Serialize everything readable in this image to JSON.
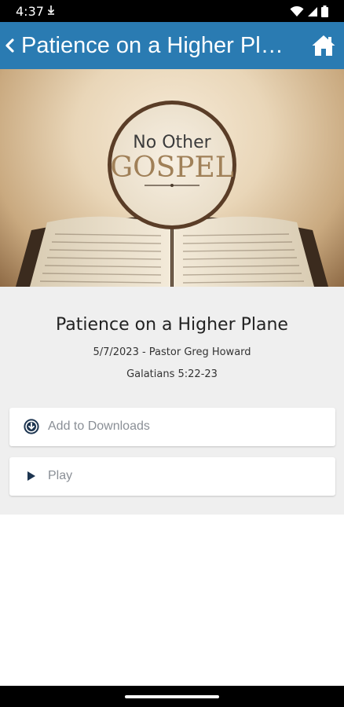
{
  "status_bar": {
    "time": "4:37"
  },
  "app_bar": {
    "title": "Patience on a Higher Plane"
  },
  "hero": {
    "line1": "No Other",
    "line2": "GOSPEL"
  },
  "sermon": {
    "title": "Patience on a Higher Plane",
    "date_speaker": "5/7/2023 - Pastor Greg Howard",
    "scripture": "Galatians 5:22-23"
  },
  "actions": {
    "download_label": "Add to Downloads",
    "play_label": "Play"
  },
  "colors": {
    "app_bar": "#2a7bb2",
    "icon_dark": "#1d3550",
    "label_gray": "#8a8f96",
    "background": "#efefef"
  }
}
